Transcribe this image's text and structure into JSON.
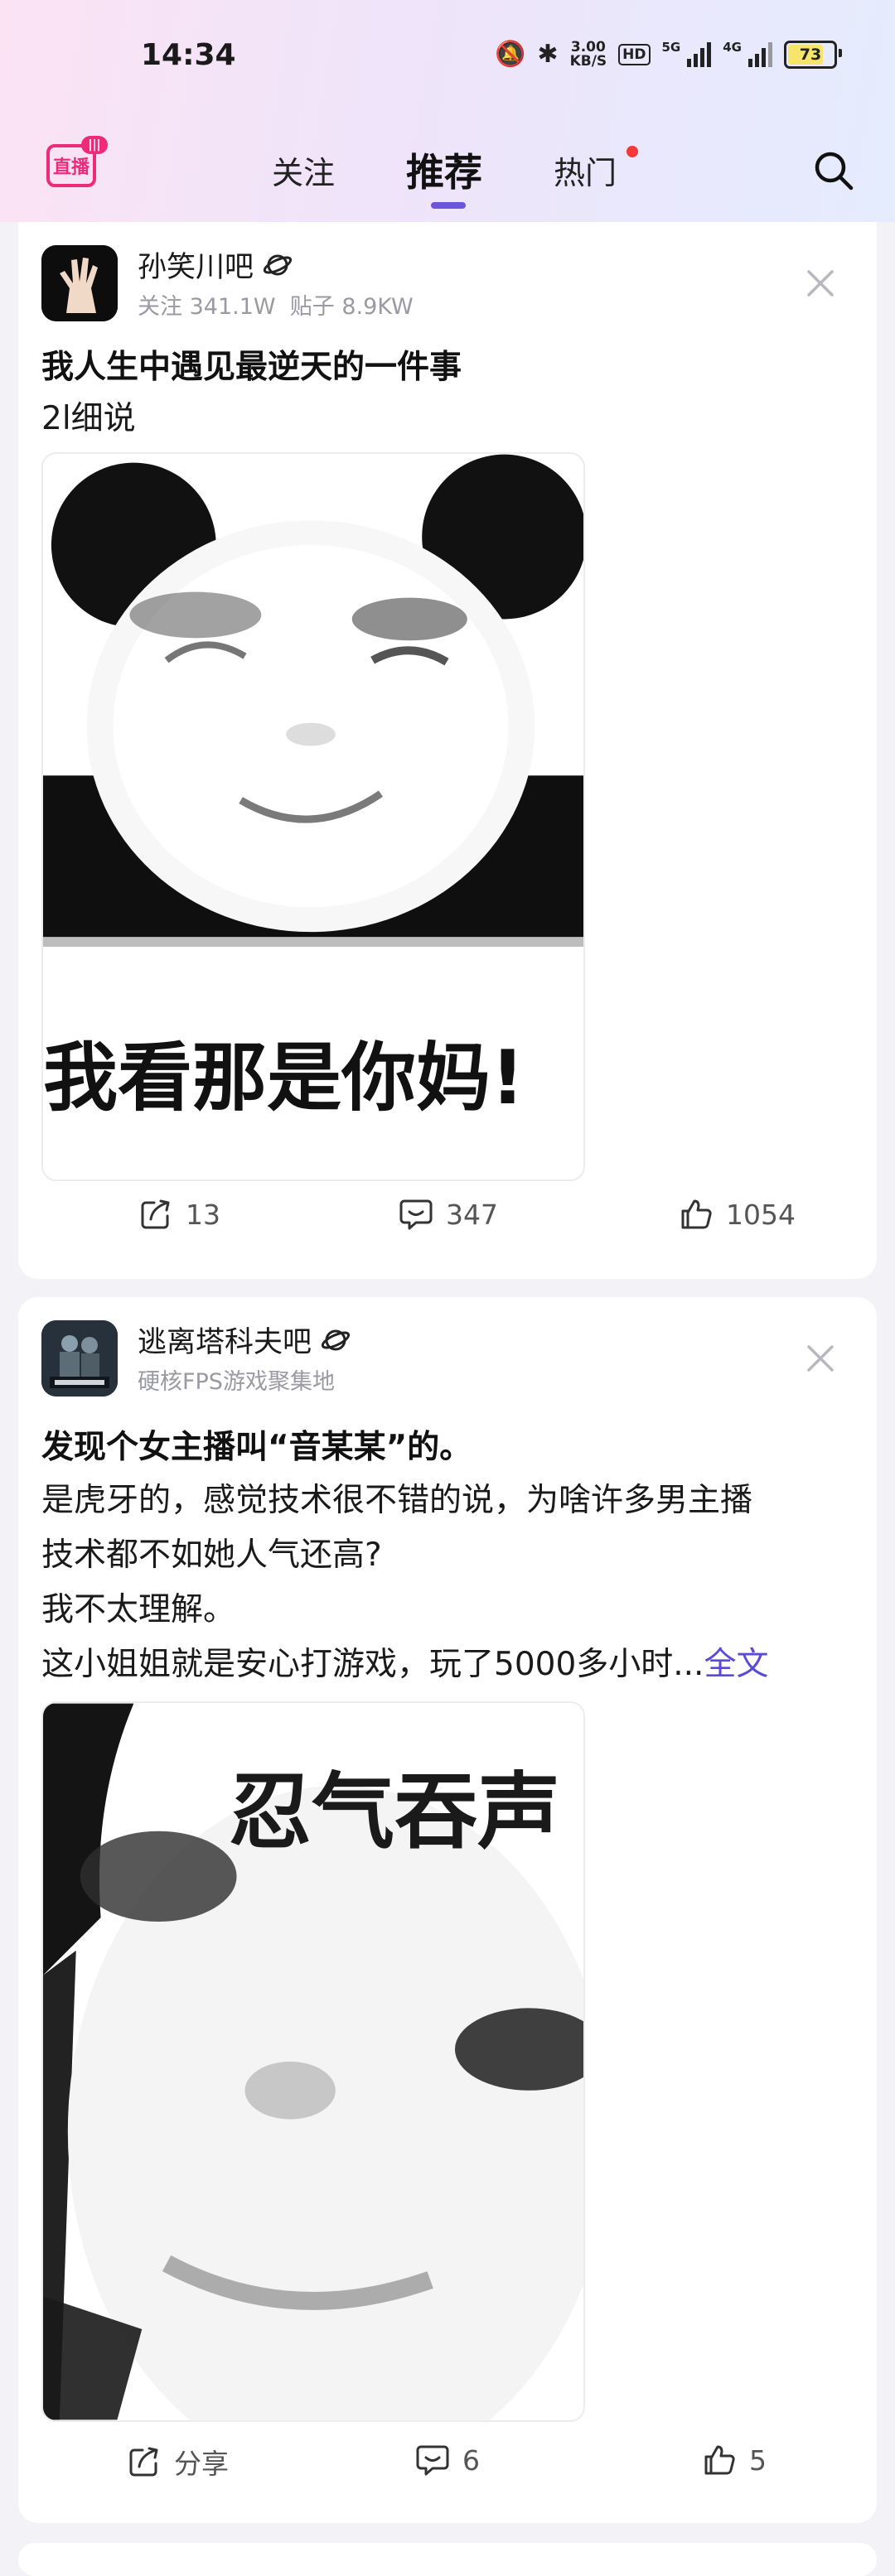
{
  "status_bar": {
    "time": "14:34",
    "net_speed": "3.00",
    "net_unit": "KB/S",
    "hd_badge": "HD",
    "signal1": "5G",
    "signal2": "4G",
    "battery": "73"
  },
  "nav": {
    "tabs": [
      {
        "label": "关注"
      },
      {
        "label": "推荐"
      },
      {
        "label": "热门"
      }
    ],
    "active_tab": "推荐",
    "live_logo_text": "直播"
  },
  "posts": [
    {
      "forum": "孙笑川吧",
      "meta_follow": "关注 341.1W",
      "meta_posts": "贴子 8.9KW",
      "title": "我人生中遇见最逆天的一件事",
      "body": [
        "2l细说"
      ],
      "image_caption": "我看那是你妈!",
      "actions": {
        "share": "13",
        "comments": "347",
        "likes": "1054"
      }
    },
    {
      "forum": "逃离塔科夫吧",
      "subtitle": "硬核FPS游戏聚集地",
      "title": "发现个女主播叫“音某某”的。",
      "body": [
        "是虎牙的，感觉技术很不错的说，为啥许多男主播",
        "技术都不如她人气还高?",
        "我不太理解。",
        "这小姐姐就是安心打游戏，玩了5000多小时..."
      ],
      "full_text_link": "全文",
      "image_caption": "忍气吞声",
      "actions": {
        "share": "分享",
        "comments": "6",
        "likes": "5"
      }
    }
  ],
  "colors": {
    "accent": "#6c55d9",
    "live_pink": "#ee2a7b",
    "hot_dot": "#f23a3a",
    "link": "#5a4bd6"
  }
}
